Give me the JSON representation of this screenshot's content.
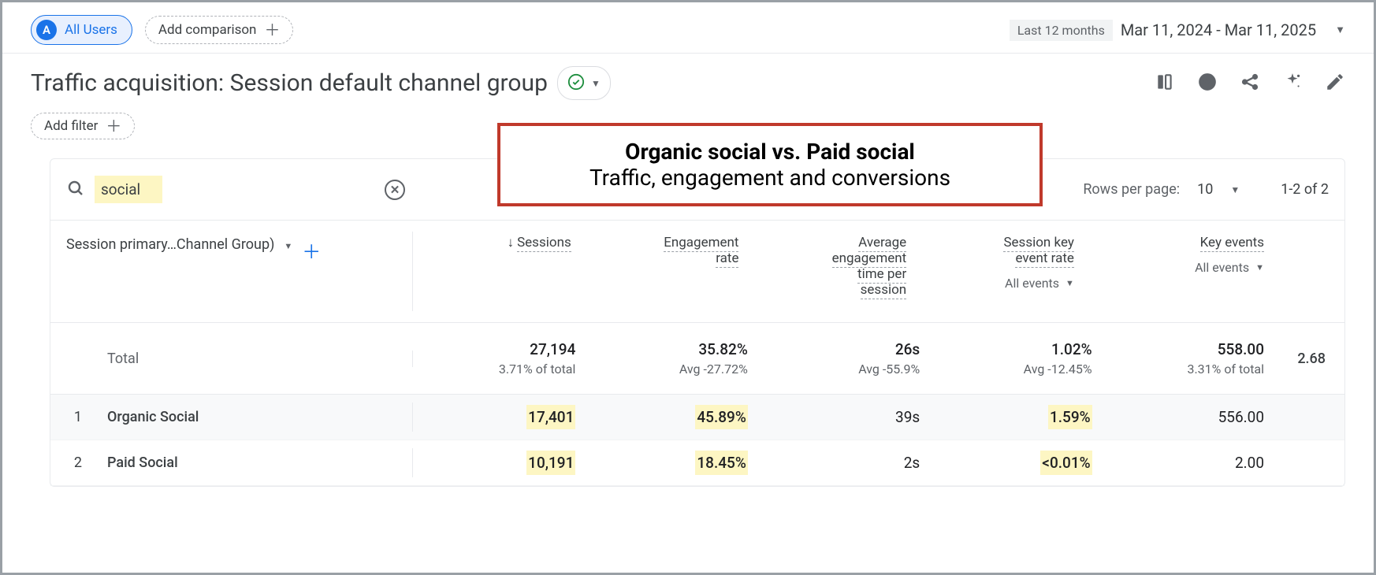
{
  "header": {
    "all_users_chip": "All Users",
    "all_users_badge": "A",
    "add_comparison": "Add comparison",
    "date_preset": "Last 12 months",
    "date_range": "Mar 11, 2024 - Mar 11, 2025"
  },
  "page": {
    "title": "Traffic acquisition: Session default channel group",
    "add_filter": "Add filter"
  },
  "annotation": {
    "title": "Organic social vs. Paid social",
    "subtitle": "Traffic, engagement and conversions"
  },
  "table": {
    "search_term": "social",
    "rows_per_page_label": "Rows per page:",
    "rows_per_page_value": "10",
    "pagination": "1-2 of 2",
    "dimension_label": "Session primary…Channel Group)",
    "columns": {
      "sessions": "Sessions",
      "engagement_rate_l1": "Engagement",
      "engagement_rate_l2": "rate",
      "avg_time_l1": "Average",
      "avg_time_l2": "engagement",
      "avg_time_l3": "time per",
      "avg_time_l4": "session",
      "ske_rate_l1": "Session key",
      "ske_rate_l2": "event rate",
      "key_events": "Key events",
      "all_events": "All events"
    },
    "totals": {
      "label": "Total",
      "sessions": "27,194",
      "sessions_sub": "3.71% of total",
      "eng_rate": "35.82%",
      "eng_rate_sub": "Avg -27.72%",
      "avg_time": "26s",
      "avg_time_sub": "Avg -55.9%",
      "ske_rate": "1.02%",
      "ske_rate_sub": "Avg -12.45%",
      "key_events": "558.00",
      "key_events_sub": "3.31% of total",
      "trailing": "2.68"
    },
    "rows": [
      {
        "num": "1",
        "label": "Organic Social",
        "sessions": "17,401",
        "eng_rate": "45.89%",
        "avg_time": "39s",
        "ske_rate": "1.59%",
        "key_events": "556.00"
      },
      {
        "num": "2",
        "label": "Paid Social",
        "sessions": "10,191",
        "eng_rate": "18.45%",
        "avg_time": "2s",
        "ske_rate": "<0.01%",
        "key_events": "2.00"
      }
    ]
  }
}
